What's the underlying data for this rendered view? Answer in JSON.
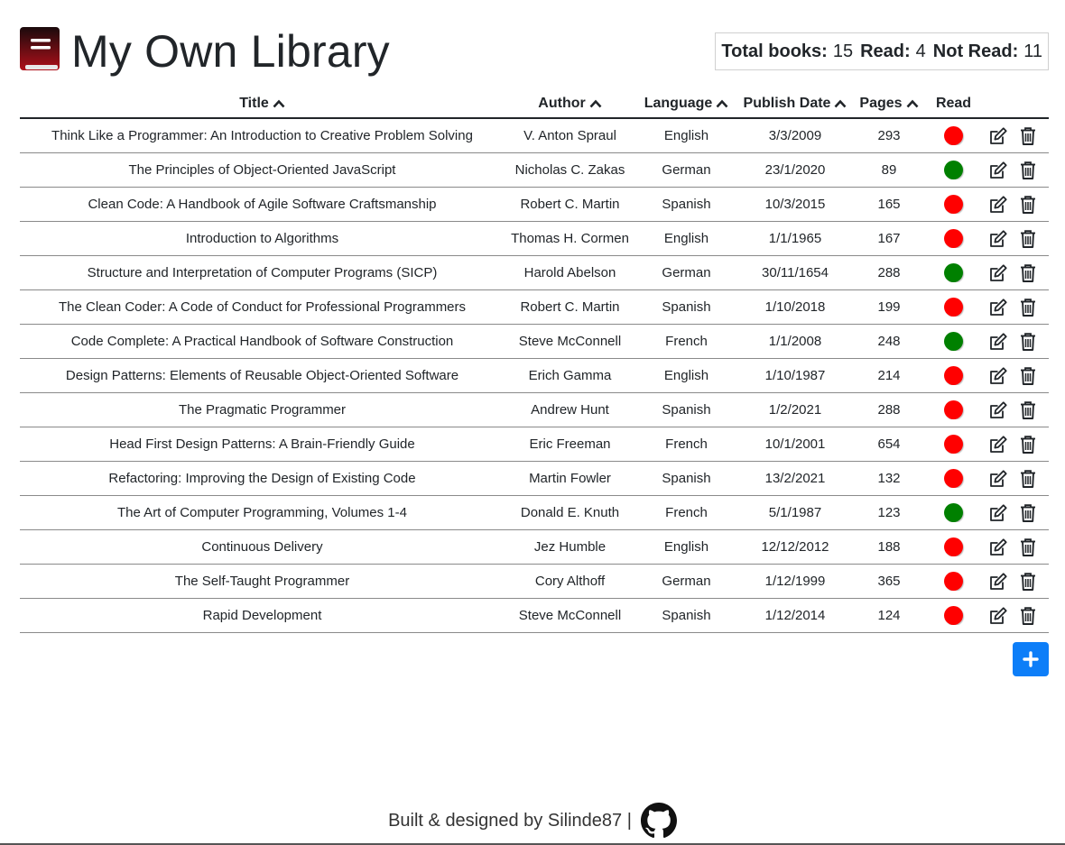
{
  "app": {
    "title": "My Own Library",
    "icon": "book-icon"
  },
  "stats": {
    "total_label": "Total books:",
    "total_value": "15",
    "read_label": "Read:",
    "read_value": "4",
    "notread_label": "Not Read:",
    "notread_value": "11"
  },
  "columns": {
    "title": "Title",
    "author": "Author",
    "language": "Language",
    "date": "Publish Date",
    "pages": "Pages",
    "read": "Read"
  },
  "colors": {
    "read": "#008000",
    "unread": "#ff0000",
    "accent": "#0d7ef8"
  },
  "books": [
    {
      "title": "Think Like a Programmer: An Introduction to Creative Problem Solving",
      "author": "V. Anton Spraul",
      "language": "English",
      "date": "3/3/2009",
      "pages": "293",
      "read": false
    },
    {
      "title": "The Principles of Object-Oriented JavaScript",
      "author": "Nicholas C. Zakas",
      "language": "German",
      "date": "23/1/2020",
      "pages": "89",
      "read": true
    },
    {
      "title": "Clean Code: A Handbook of Agile Software Craftsmanship",
      "author": "Robert C. Martin",
      "language": "Spanish",
      "date": "10/3/2015",
      "pages": "165",
      "read": false
    },
    {
      "title": "Introduction to Algorithms",
      "author": "Thomas H. Cormen",
      "language": "English",
      "date": "1/1/1965",
      "pages": "167",
      "read": false
    },
    {
      "title": "Structure and Interpretation of Computer Programs (SICP)",
      "author": "Harold Abelson",
      "language": "German",
      "date": "30/11/1654",
      "pages": "288",
      "read": true
    },
    {
      "title": "The Clean Coder: A Code of Conduct for Professional Programmers",
      "author": "Robert C. Martin",
      "language": "Spanish",
      "date": "1/10/2018",
      "pages": "199",
      "read": false
    },
    {
      "title": "Code Complete: A Practical Handbook of Software Construction",
      "author": "Steve McConnell",
      "language": "French",
      "date": "1/1/2008",
      "pages": "248",
      "read": true
    },
    {
      "title": "Design Patterns: Elements of Reusable Object-Oriented Software",
      "author": "Erich Gamma",
      "language": "English",
      "date": "1/10/1987",
      "pages": "214",
      "read": false
    },
    {
      "title": "The Pragmatic Programmer",
      "author": "Andrew Hunt",
      "language": "Spanish",
      "date": "1/2/2021",
      "pages": "288",
      "read": false
    },
    {
      "title": "Head First Design Patterns: A Brain-Friendly Guide",
      "author": "Eric Freeman",
      "language": "French",
      "date": "10/1/2001",
      "pages": "654",
      "read": false
    },
    {
      "title": "Refactoring: Improving the Design of Existing Code",
      "author": "Martin Fowler",
      "language": "Spanish",
      "date": "13/2/2021",
      "pages": "132",
      "read": false
    },
    {
      "title": "The Art of Computer Programming, Volumes 1-4",
      "author": "Donald E. Knuth",
      "language": "French",
      "date": "5/1/1987",
      "pages": "123",
      "read": true
    },
    {
      "title": "Continuous Delivery",
      "author": "Jez Humble",
      "language": "English",
      "date": "12/12/2012",
      "pages": "188",
      "read": false
    },
    {
      "title": "The Self-Taught Programmer",
      "author": "Cory Althoff",
      "language": "German",
      "date": "1/12/1999",
      "pages": "365",
      "read": false
    },
    {
      "title": "Rapid Development",
      "author": "Steve McConnell",
      "language": "Spanish",
      "date": "1/12/2014",
      "pages": "124",
      "read": false
    }
  ],
  "actions": {
    "edit_icon": "edit-icon",
    "delete_icon": "trash-icon",
    "add_icon": "plus-icon"
  },
  "footer": {
    "text": "Built & designed by Silinde87 |",
    "icon": "github-icon"
  }
}
